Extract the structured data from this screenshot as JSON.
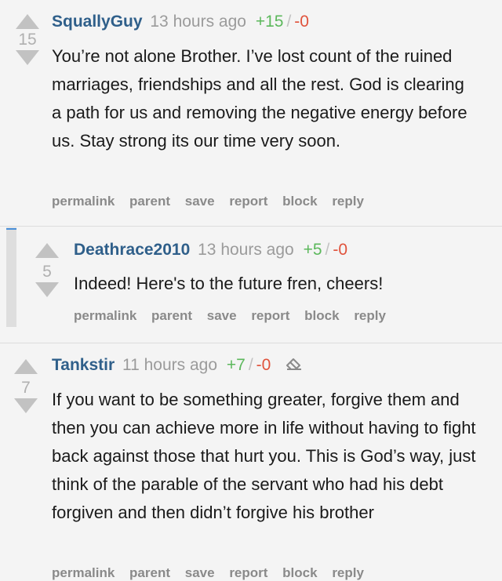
{
  "comments": [
    {
      "author": "SquallyGuy",
      "time": "13 hours ago",
      "up": "+15",
      "slash": "/",
      "down": "-0",
      "score": "15",
      "body": "You’re not alone Brother. I’ve lost count of the ruined marriages, friendships and all the rest. God is clearing a path for us and removing the negative energy before us. Stay strong its our time very soon.",
      "actions": [
        "permalink",
        "parent",
        "save",
        "report",
        "block",
        "reply"
      ]
    },
    {
      "author": "Deathrace2010",
      "time": "13 hours ago",
      "up": "+5",
      "slash": "/",
      "down": "-0",
      "score": "5",
      "body": "Indeed! Here's to the future fren, cheers!",
      "actions": [
        "permalink",
        "parent",
        "save",
        "report",
        "block",
        "reply"
      ]
    },
    {
      "author": "Tankstir",
      "time": "11 hours ago",
      "up": "+7",
      "slash": "/",
      "down": "-0",
      "score": "7",
      "body": "If you want to be something greater, forgive them and then you can achieve more in life without having to fight back against those that hurt you. This is God’s way, just think of the parable of the servant who had his debt forgiven and then didn’t forgive his brother",
      "actions": [
        "permalink",
        "parent",
        "save",
        "report",
        "block",
        "reply"
      ],
      "extra_icon": "eraser-icon"
    }
  ],
  "colors": {
    "author": "#2f5f8a",
    "upvotes": "#5cb85c",
    "downvotes": "#e0533c",
    "collapse_indicator": "#4a90d9"
  }
}
